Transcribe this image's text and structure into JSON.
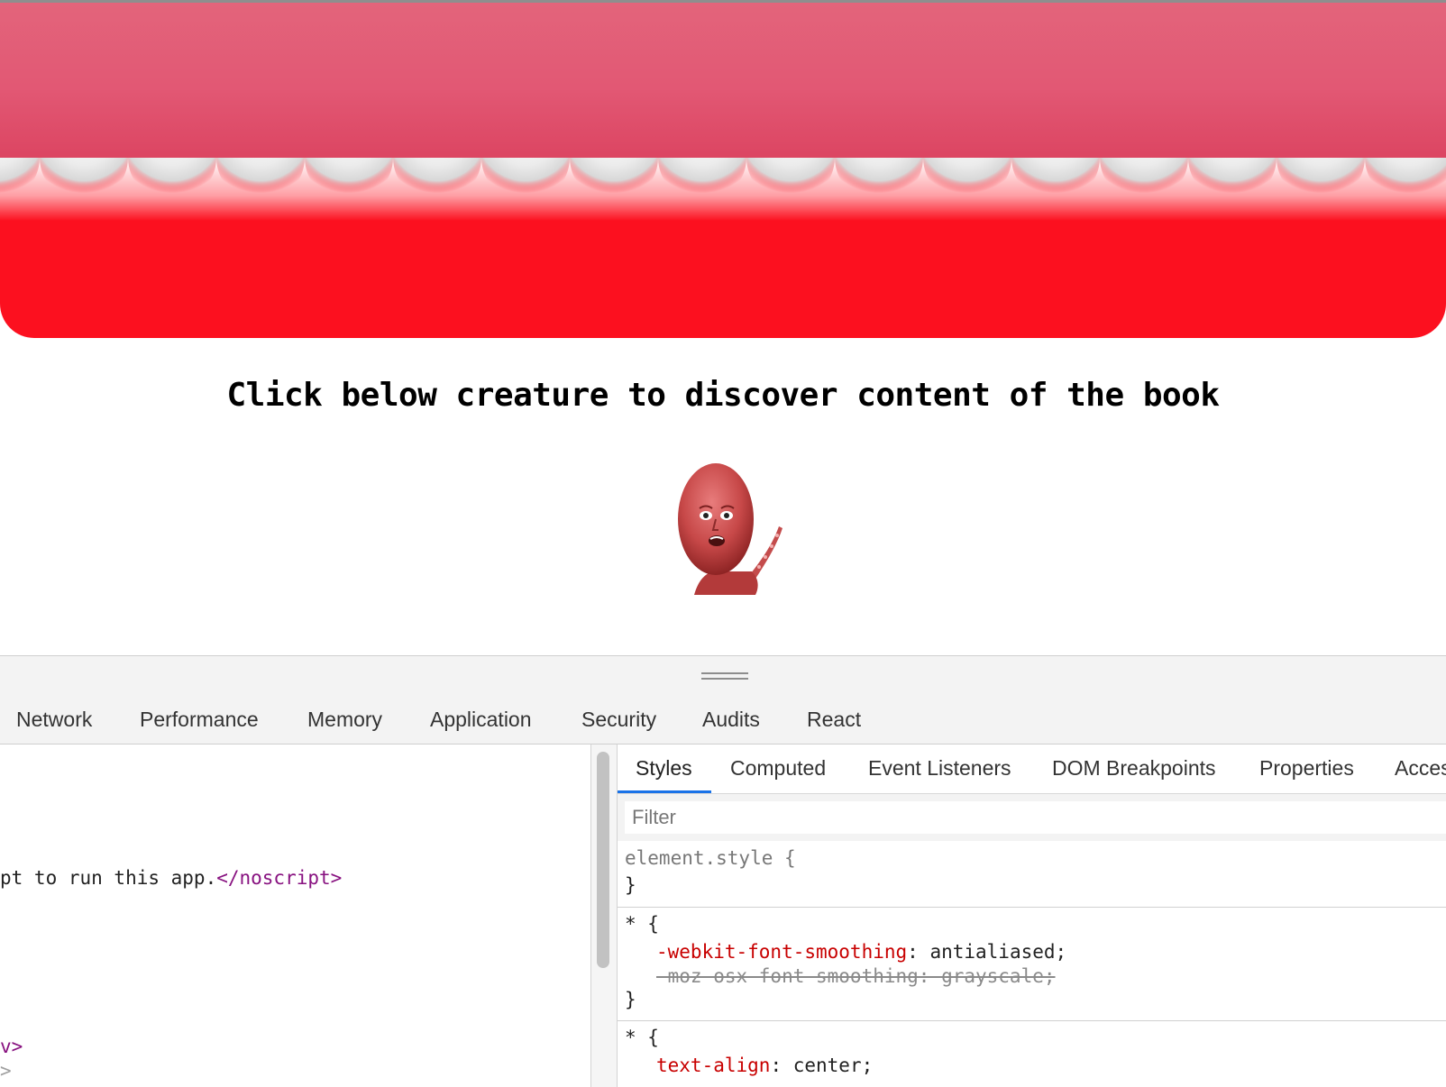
{
  "page": {
    "heading": "Click below creature to discover content of the book",
    "colors": {
      "awning_top": "#e25874",
      "awning_body": "#fc101f",
      "scallop": "#e8e8e8"
    }
  },
  "devtools": {
    "main_tabs": [
      "Network",
      "Performance",
      "Memory",
      "Application",
      "Security",
      "Audits",
      "React"
    ],
    "elements": {
      "noscript_text": "pt to run this app.",
      "noscript_close": "</noscript>",
      "partial_close_1": "v>",
      "partial_close_2": ">"
    },
    "styles": {
      "subtabs": [
        "Styles",
        "Computed",
        "Event Listeners",
        "DOM Breakpoints",
        "Properties",
        "Acces"
      ],
      "active_subtab": "Styles",
      "filter_placeholder": "Filter",
      "rule_element_style": "element.style {",
      "close_brace": "}",
      "rule2_selector": "* {",
      "rule2_prop1": "-webkit-font-smoothing",
      "rule2_val1": ": antialiased;",
      "rule2_struck": "-moz-osx-font-smoothing: grayscale;",
      "rule3_selector": "* {",
      "rule3_prop1": "text-align",
      "rule3_val1": ": center;"
    }
  }
}
